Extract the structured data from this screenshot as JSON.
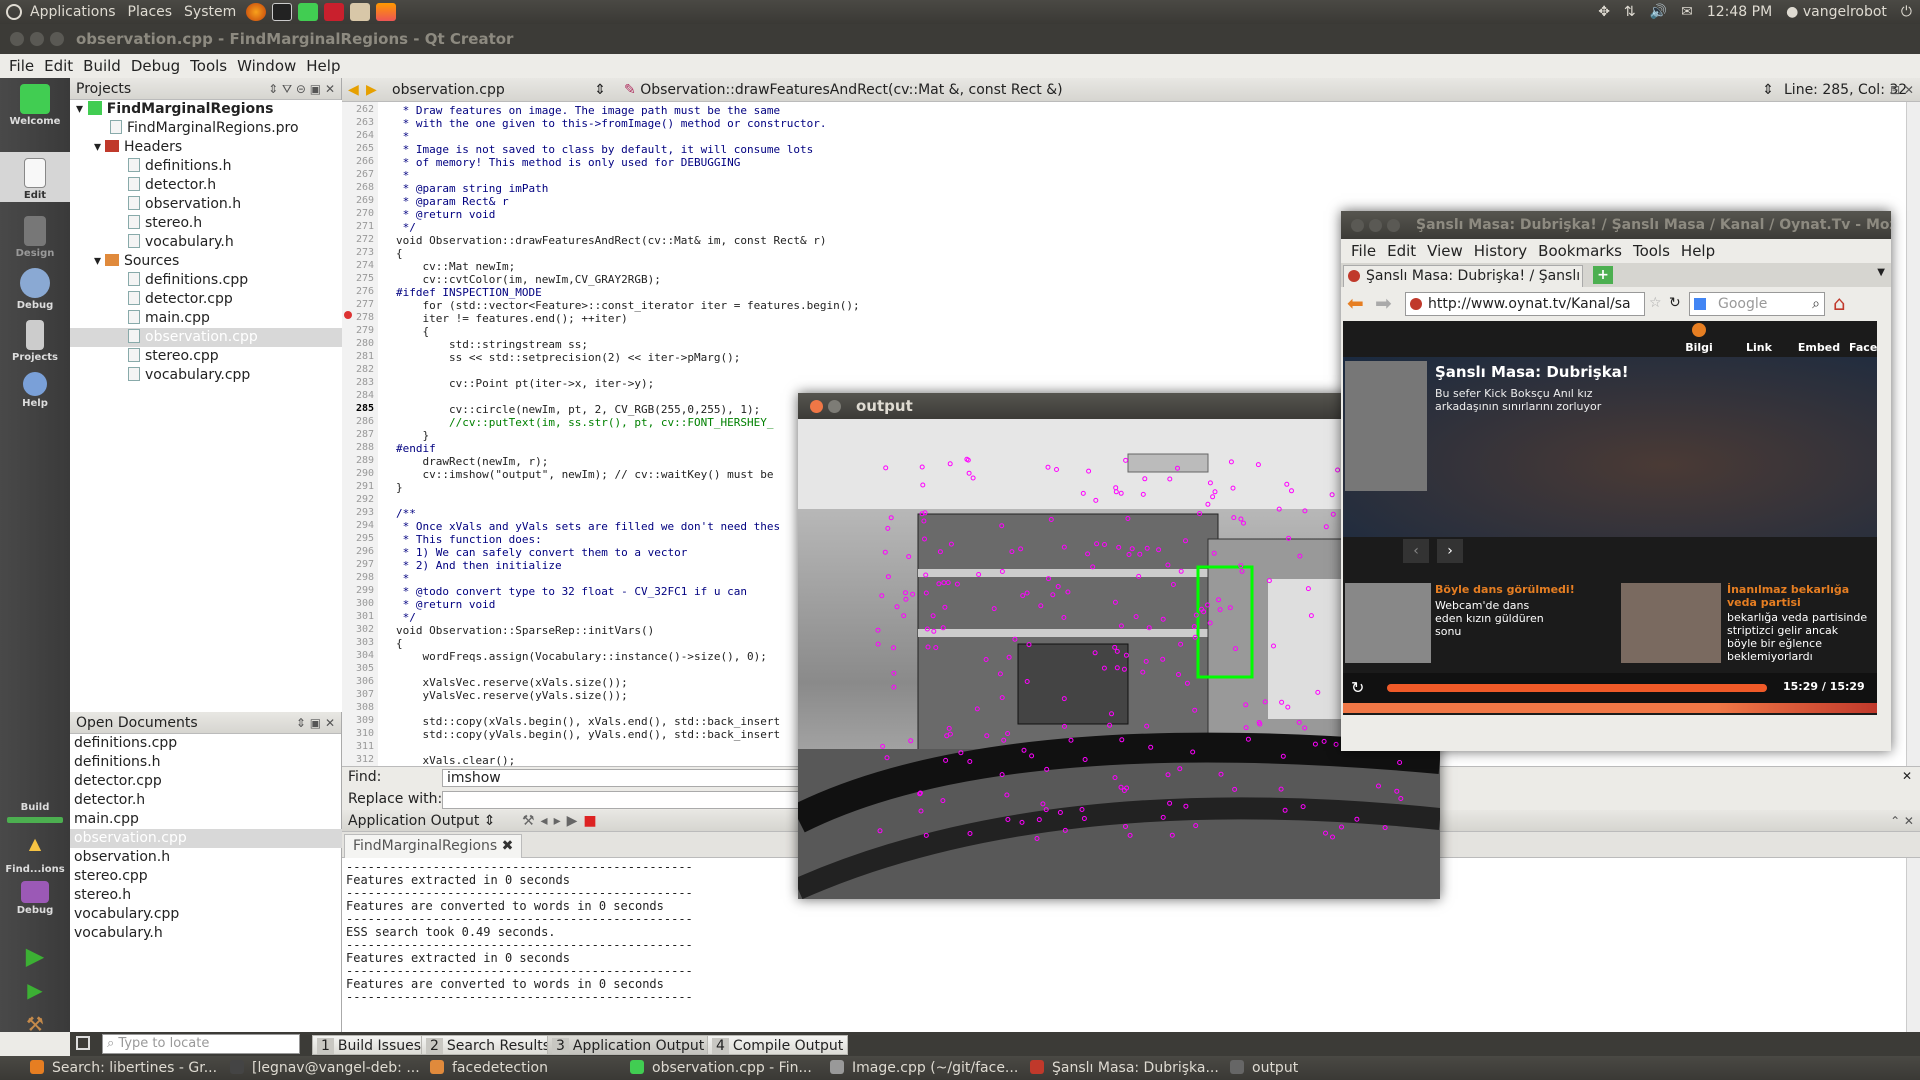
{
  "top_panel": {
    "menus": [
      "Applications",
      "Places",
      "System"
    ],
    "clock": "12:48 PM",
    "user": "vangelrobot"
  },
  "qt": {
    "title": "observation.cpp - FindMarginalRegions - Qt Creator",
    "menus": [
      "File",
      "Edit",
      "Build",
      "Debug",
      "Tools",
      "Window",
      "Help"
    ],
    "modes": [
      "Welcome",
      "Edit",
      "Design",
      "Debug",
      "Projects",
      "Help"
    ],
    "mode_build": "Build",
    "mode_find": "Find...ions",
    "mode_debug": "Debug",
    "projects_title": "Projects",
    "project": {
      "name": "FindMarginalRegions",
      "pro": "FindMarginalRegions.pro",
      "headers_label": "Headers",
      "headers": [
        "definitions.h",
        "detector.h",
        "observation.h",
        "stereo.h",
        "vocabulary.h"
      ],
      "sources_label": "Sources",
      "sources": [
        "definitions.cpp",
        "detector.cpp",
        "main.cpp",
        "observation.cpp",
        "stereo.cpp",
        "vocabulary.cpp"
      ]
    },
    "open_docs_title": "Open Documents",
    "open_docs": [
      "definitions.cpp",
      "definitions.h",
      "detector.cpp",
      "detector.h",
      "main.cpp",
      "observation.cpp",
      "observation.h",
      "stereo.cpp",
      "stereo.h",
      "vocabulary.cpp",
      "vocabulary.h"
    ],
    "editor": {
      "file": "observation.cpp",
      "function": "Observation::drawFeaturesAndRect(cv::Mat &, const Rect &)",
      "position": "Line: 285, Col: 32"
    },
    "code": [
      {
        "n": "262",
        "t": " * Draw features on image. The image path must be the same",
        "c": "cm"
      },
      {
        "n": "263",
        "t": " * with the one given to this->fromImage() method or constructor.",
        "c": "cm"
      },
      {
        "n": "264",
        "t": " *",
        "c": "cm"
      },
      {
        "n": "265",
        "t": " * Image is not saved to class by default, it will consume lots",
        "c": "cm"
      },
      {
        "n": "266",
        "t": " * of memory! This method is only used for DEBUGGING",
        "c": "cm"
      },
      {
        "n": "267",
        "t": " *",
        "c": "cm"
      },
      {
        "n": "268",
        "t": " * @param string imPath",
        "c": "cm"
      },
      {
        "n": "269",
        "t": " * @param Rect& r",
        "c": "cm"
      },
      {
        "n": "270",
        "t": " * @return void",
        "c": "cm"
      },
      {
        "n": "271",
        "t": " */",
        "c": "cm"
      },
      {
        "n": "272",
        "t": "void Observation::drawFeaturesAndRect(cv::Mat& im, const Rect& r)",
        "c": ""
      },
      {
        "n": "273",
        "t": "{",
        "c": ""
      },
      {
        "n": "274",
        "t": "    cv::Mat newIm;",
        "c": ""
      },
      {
        "n": "275",
        "t": "    cv::cvtColor(im, newIm,CV_GRAY2RGB);",
        "c": ""
      },
      {
        "n": "276",
        "t": "#ifdef INSPECTION_MODE",
        "c": "pp"
      },
      {
        "n": "277",
        "t": "    for (std::vector<Feature>::const_iterator iter = features.begin();",
        "c": ""
      },
      {
        "n": "278",
        "t": "    iter != features.end(); ++iter)",
        "c": ""
      },
      {
        "n": "279",
        "t": "    {",
        "c": ""
      },
      {
        "n": "280",
        "t": "        std::stringstream ss;",
        "c": ""
      },
      {
        "n": "281",
        "t": "        ss << std::setprecision(2) << iter->pMarg();",
        "c": ""
      },
      {
        "n": "282",
        "t": "",
        "c": ""
      },
      {
        "n": "283",
        "t": "        cv::Point pt(iter->x, iter->y);",
        "c": ""
      },
      {
        "n": "284",
        "t": "",
        "c": ""
      },
      {
        "n": "285",
        "t": "        cv::circle(newIm, pt, 2, CV_RGB(255,0,255), 1);",
        "c": ""
      },
      {
        "n": "286",
        "t": "        //cv::putText(im, ss.str(), pt, cv::FONT_HERSHEY_",
        "c": "st"
      },
      {
        "n": "287",
        "t": "    }",
        "c": ""
      },
      {
        "n": "288",
        "t": "#endif",
        "c": "pp"
      },
      {
        "n": "289",
        "t": "    drawRect(newIm, r);",
        "c": ""
      },
      {
        "n": "290",
        "t": "    cv::imshow(\"output\", newIm); // cv::waitKey() must be",
        "c": ""
      },
      {
        "n": "291",
        "t": "}",
        "c": ""
      },
      {
        "n": "292",
        "t": "",
        "c": ""
      },
      {
        "n": "293",
        "t": "/**",
        "c": "cm"
      },
      {
        "n": "294",
        "t": " * Once xVals and yVals sets are filled we don't need thes",
        "c": "cm"
      },
      {
        "n": "295",
        "t": " * This function does:",
        "c": "cm"
      },
      {
        "n": "296",
        "t": " * 1) We can safely convert them to a vector",
        "c": "cm"
      },
      {
        "n": "297",
        "t": " * 2) And then initialize",
        "c": "cm"
      },
      {
        "n": "298",
        "t": " *",
        "c": "cm"
      },
      {
        "n": "299",
        "t": " * @todo convert type to 32 float - CV_32FC1 if u can",
        "c": "cm"
      },
      {
        "n": "300",
        "t": " * @return void",
        "c": "cm"
      },
      {
        "n": "301",
        "t": " */",
        "c": "cm"
      },
      {
        "n": "302",
        "t": "void Observation::SparseRep::initVars()",
        "c": ""
      },
      {
        "n": "303",
        "t": "{",
        "c": ""
      },
      {
        "n": "304",
        "t": "    wordFreqs.assign(Vocabulary::instance()->size(), 0);",
        "c": ""
      },
      {
        "n": "305",
        "t": "",
        "c": ""
      },
      {
        "n": "306",
        "t": "    xValsVec.reserve(xVals.size());",
        "c": ""
      },
      {
        "n": "307",
        "t": "    yValsVec.reserve(yVals.size());",
        "c": ""
      },
      {
        "n": "308",
        "t": "",
        "c": ""
      },
      {
        "n": "309",
        "t": "    std::copy(xVals.begin(), xVals.end(), std::back_insert",
        "c": ""
      },
      {
        "n": "310",
        "t": "    std::copy(yVals.begin(), yVals.end(), std::back_insert",
        "c": ""
      },
      {
        "n": "311",
        "t": "",
        "c": ""
      },
      {
        "n": "312",
        "t": "    xVals.clear();",
        "c": ""
      }
    ],
    "find_label": "Find:",
    "find_value": "imshow",
    "replace_label": "Replace with:",
    "output_title": "Application Output",
    "output_tab": "FindMarginalRegions",
    "output_lines": [
      "------------------------------------------------",
      "Features extracted in 0 seconds",
      "------------------------------------------------",
      "Features are converted to words in 0 seconds",
      "------------------------------------------------",
      "ESS search took 0.49 seconds.",
      "------------------------------------------------",
      "Features extracted in 0 seconds",
      "------------------------------------------------",
      "Features are converted to words in 0 seconds",
      "------------------------------------------------"
    ],
    "locate_placeholder": "Type to locate",
    "bottom_tabs": [
      {
        "num": "1",
        "label": "Build Issues"
      },
      {
        "num": "2",
        "label": "Search Results"
      },
      {
        "num": "3",
        "label": "Application Output"
      },
      {
        "num": "4",
        "label": "Compile Output"
      }
    ]
  },
  "cv_window": {
    "title": "output"
  },
  "firefox": {
    "title": "Şanslı Masa: Dubrişka! / Şanslı Masa / Kanal / Oynat.Tv - Mozilla Firefox",
    "menus": [
      "File",
      "Edit",
      "View",
      "History",
      "Bookmarks",
      "Tools",
      "Help"
    ],
    "tab": "Şanslı Masa: Dubrişka! / Şanslı ...",
    "url": "http://www.oynat.tv/Kanal/sa",
    "search_placeholder": "Google",
    "video_buttons": [
      "Bilgi",
      "Link",
      "Embed",
      "Faceb"
    ],
    "video_title": "Şanslı Masa: Dubrişka!",
    "video_desc": "Bu sefer Kick Boksçu Anıl kız arkadaşının sınırlarını zorluyor",
    "rel1_title": "Böyle dans görülmedi!",
    "rel1_desc": "Webcam'de dans eden kızın güldüren sonu",
    "rel2_title": "İnanılmaz bekarlığa veda partisi",
    "rel2_desc": "bekarlığa veda partisinde striptizci gelir ancak böyle bir eğlence beklemiyorlardı",
    "time": "15:29 / 15:29",
    "progress": 1.0
  },
  "taskbar": [
    "Search: libertines - Gr...",
    "[legnav@vangel-deb: ...",
    "facedetection",
    "observation.cpp - Fin...",
    "Image.cpp (~/git/face...",
    "Şanslı Masa: Dubrişka...",
    "output"
  ],
  "colors": {
    "panel": "#3c3b37",
    "accent": "#f07746",
    "selection": "#d8d8d8",
    "feature": "#ff00ff",
    "rect": "#00ff00"
  }
}
